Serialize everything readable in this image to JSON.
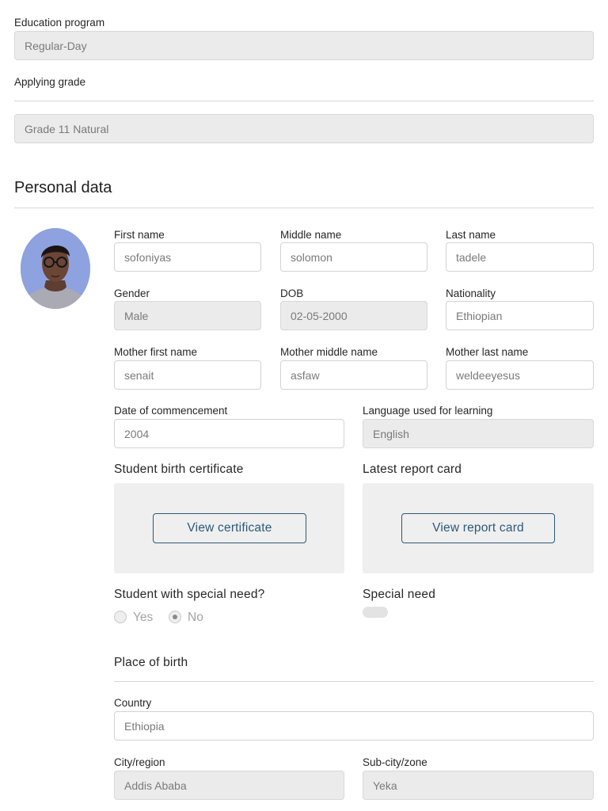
{
  "education": {
    "program_label": "Education program",
    "program_value": "Regular-Day",
    "grade_label": "Applying grade",
    "grade_value": "Grade 11 Natural"
  },
  "personal": {
    "title": "Personal data",
    "first_name": {
      "label": "First name",
      "value": "sofoniyas"
    },
    "middle_name": {
      "label": "Middle name",
      "value": "solomon"
    },
    "last_name": {
      "label": "Last name",
      "value": "tadele"
    },
    "gender": {
      "label": "Gender",
      "value": "Male"
    },
    "dob": {
      "label": "DOB",
      "value": "02-05-2000"
    },
    "nationality": {
      "label": "Nationality",
      "value": "Ethiopian"
    },
    "mother_first": {
      "label": "Mother first name",
      "value": "senait"
    },
    "mother_middle": {
      "label": "Mother middle name",
      "value": "asfaw"
    },
    "mother_last": {
      "label": "Mother last name",
      "value": "weldeeyesus"
    },
    "commencement": {
      "label": "Date of commencement",
      "value": "2004"
    },
    "language": {
      "label": "Language used for learning",
      "value": "English"
    }
  },
  "documents": {
    "birth_cert_label": "Student birth certificate",
    "birth_cert_button": "View certificate",
    "report_card_label": "Latest report card",
    "report_card_button": "View report card"
  },
  "special": {
    "question": "Student with special need?",
    "yes": "Yes",
    "no": "No",
    "selected": "No",
    "need_label": "Special need"
  },
  "birth_place": {
    "title": "Place of birth",
    "country": {
      "label": "Country",
      "value": "Ethiopia"
    },
    "city": {
      "label": "City/region",
      "value": "Addis Ababa"
    },
    "subcity": {
      "label": "Sub-city/zone",
      "value": "Yeka"
    }
  },
  "colors": {
    "accent": "#2c5878",
    "disabled_bg": "#ebebeb",
    "avatar_bg": "#8ea2e0"
  },
  "icons": {
    "avatar": "student-photo"
  }
}
